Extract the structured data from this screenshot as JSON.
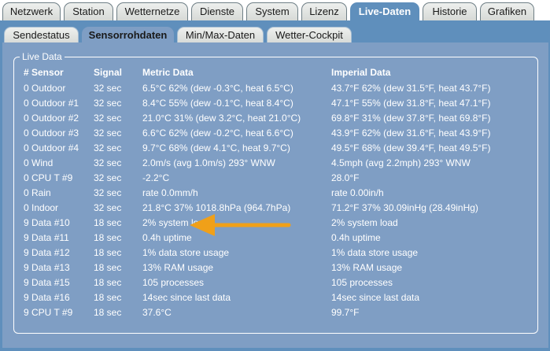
{
  "main_tabs": [
    {
      "label": "Netzwerk"
    },
    {
      "label": "Station"
    },
    {
      "label": "Wetternetze"
    },
    {
      "label": "Dienste"
    },
    {
      "label": "System"
    },
    {
      "label": "Lizenz"
    },
    {
      "label": "Live-Daten"
    },
    {
      "label": "Historie"
    },
    {
      "label": "Grafiken"
    }
  ],
  "sub_tabs": [
    {
      "label": "Sendestatus"
    },
    {
      "label": "Sensorrohdaten"
    },
    {
      "label": "Min/Max-Daten"
    },
    {
      "label": "Wetter-Cockpit"
    }
  ],
  "active_main_tab": "Live-Daten",
  "active_sub_tab": "Sensorrohdaten",
  "panel": {
    "legend": "Live Data"
  },
  "table": {
    "headers": [
      "# Sensor",
      "Signal",
      "Metric Data",
      "Imperial Data"
    ],
    "rows": [
      [
        "0 Outdoor",
        "32 sec",
        "6.5°C 62% (dew -0.3°C, heat 6.5°C)",
        "43.7°F 62% (dew 31.5°F, heat 43.7°F)"
      ],
      [
        "0 Outdoor #1",
        "32 sec",
        "8.4°C 55% (dew -0.1°C, heat 8.4°C)",
        "47.1°F 55% (dew 31.8°F, heat 47.1°F)"
      ],
      [
        "0 Outdoor #2",
        "32 sec",
        "21.0°C 31% (dew 3.2°C, heat 21.0°C)",
        "69.8°F 31% (dew 37.8°F, heat 69.8°F)"
      ],
      [
        "0 Outdoor #3",
        "32 sec",
        "6.6°C 62% (dew -0.2°C, heat 6.6°C)",
        "43.9°F 62% (dew 31.6°F, heat 43.9°F)"
      ],
      [
        "0 Outdoor #4",
        "32 sec",
        "9.7°C 68% (dew 4.1°C, heat 9.7°C)",
        "49.5°F 68% (dew 39.4°F, heat 49.5°F)"
      ],
      [
        "0 Wind",
        "32 sec",
        "2.0m/s (avg 1.0m/s) 293° WNW",
        "4.5mph (avg 2.2mph) 293° WNW"
      ],
      [
        "0 CPU T #9",
        "32 sec",
        "-2.2°C",
        "28.0°F"
      ],
      [
        "0 Rain",
        "32 sec",
        "rate 0.0mm/h",
        "rate 0.00in/h"
      ],
      [
        "0 Indoor",
        "32 sec",
        "21.8°C 37% 1018.8hPa (964.7hPa)",
        "71.2°F 37% 30.09inHg (28.49inHg)"
      ],
      [
        "9 Data #10",
        "18 sec",
        "2% system load",
        "2% system load"
      ],
      [
        "9 Data #11",
        "18 sec",
        "0.4h uptime",
        "0.4h uptime"
      ],
      [
        "9 Data #12",
        "18 sec",
        "1% data store usage",
        "1% data store usage"
      ],
      [
        "9 Data #13",
        "18 sec",
        "13% RAM usage",
        "13% RAM usage"
      ],
      [
        "9 Data #15",
        "18 sec",
        "105 processes",
        "105 processes"
      ],
      [
        "9 Data #16",
        "18 sec",
        "14sec since last data",
        "14sec since last data"
      ],
      [
        "9 CPU T #9",
        "18 sec",
        "37.6°C",
        "99.7°F"
      ]
    ]
  },
  "colors": {
    "bar": "#5f8fbc",
    "panel": "#7f9ec4",
    "arrow": "#f0a019",
    "text": "#ffffff"
  },
  "annotation_icon": "orange-arrow-icon"
}
